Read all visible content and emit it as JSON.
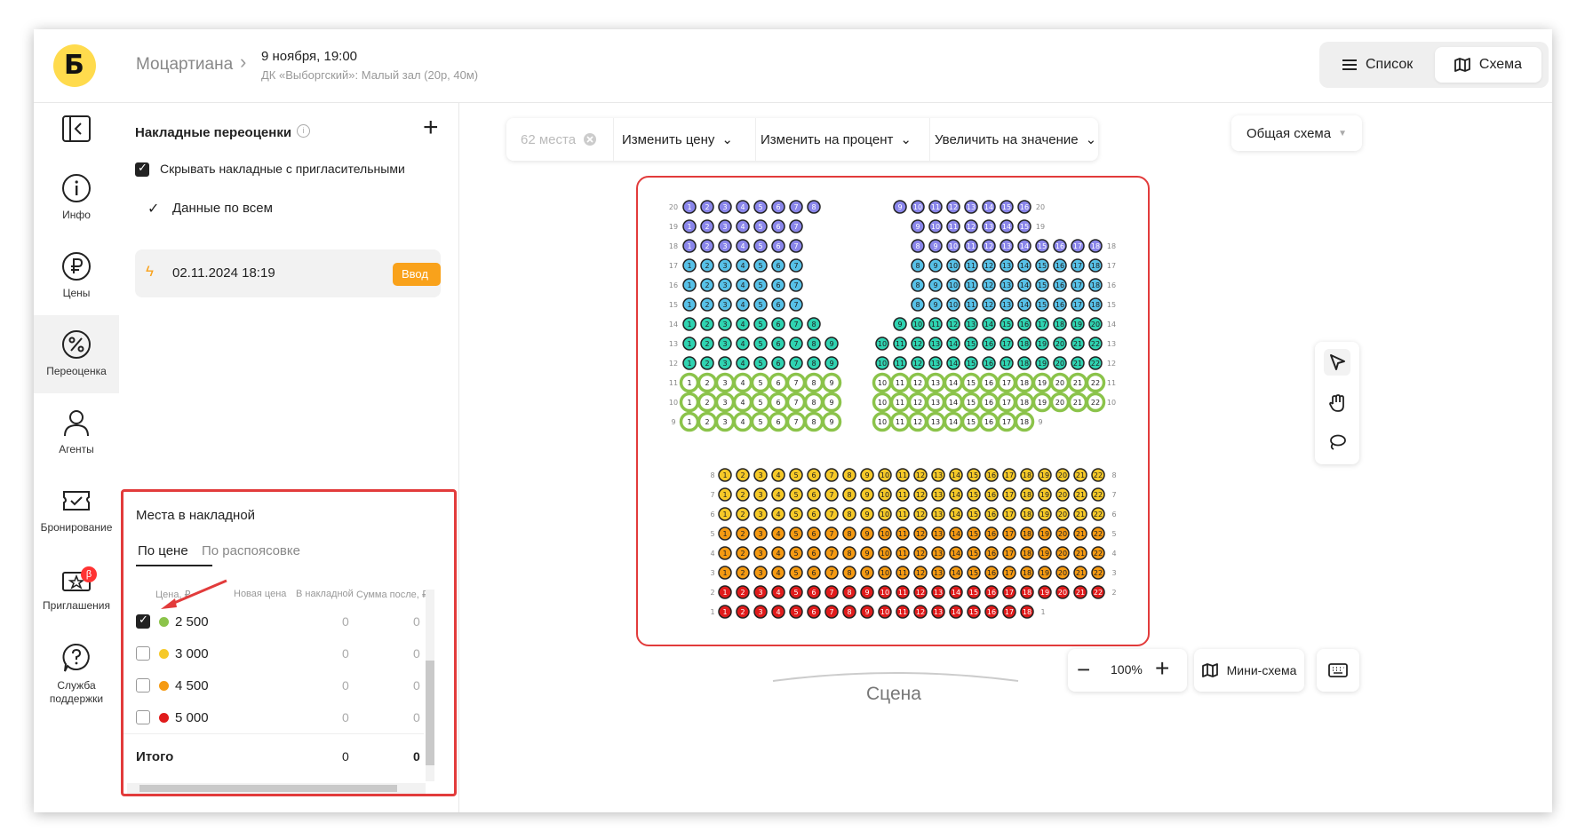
{
  "header": {
    "breadcrumb": "Моцартиана",
    "event_date": "9 ноября, 19:00",
    "event_place": "ДК «Выборгский»: Малый зал (20р, 40м)",
    "view_list": "Список",
    "view_scheme": "Схема"
  },
  "sidebar": {
    "items": [
      {
        "label": "",
        "icon": "collapse-panel-icon"
      },
      {
        "label": "Инфо",
        "icon": "info-icon"
      },
      {
        "label": "Цены",
        "icon": "ruble-icon"
      },
      {
        "label": "Переоценка",
        "icon": "percent-icon"
      },
      {
        "label": "Агенты",
        "icon": "person-icon"
      },
      {
        "label": "Бронирование",
        "icon": "ticket-icon"
      },
      {
        "label": "Приглашения",
        "icon": "invitation-icon",
        "badge": "β"
      },
      {
        "label": "Служба поддержки",
        "icon": "help-icon"
      }
    ]
  },
  "panel": {
    "title": "Накладные переоценки",
    "hide_invites_label": "Скрывать накладные с пригласительными",
    "hide_invites_checked": true,
    "all_data_label": "Данные по всем",
    "entry_date": "02.11.2024 18:19",
    "entry_button": "Ввод"
  },
  "seats_box": {
    "title": "Места в накладной",
    "tabs": [
      "По цене",
      "По распояcовке"
    ],
    "columns": [
      "Цена, ₽",
      "Новая цена",
      "В накладной",
      "Сумма после, ₽"
    ],
    "rows": [
      {
        "price": "2 500",
        "color": "#8bc34a",
        "checked": true,
        "count": "0",
        "sum": "0"
      },
      {
        "price": "3 000",
        "color": "#f6c928",
        "checked": false,
        "count": "0",
        "sum": "0"
      },
      {
        "price": "4 500",
        "color": "#f59a12",
        "checked": false,
        "count": "0",
        "sum": "0"
      },
      {
        "price": "5 000",
        "color": "#e01b1b",
        "checked": false,
        "count": "0",
        "sum": "0"
      }
    ],
    "total_label": "Итого",
    "total_count": "0",
    "total_sum": "0"
  },
  "toolbar": {
    "selected": "62 места",
    "change_price": "Изменить цену",
    "change_percent": "Изменить на процент",
    "increase_value": "Увеличить на значение"
  },
  "common_scheme": "Общая схема",
  "zoom": "100%",
  "mini_scheme": "Мини-схема",
  "stage": "Сцена",
  "colors": {
    "purple": "#8a86ea",
    "blue": "#57c1e8",
    "teal": "#2fd3b1",
    "green": "#8bc34a",
    "yellow": "#f6c928",
    "orange": "#f59a12",
    "red": "#e01b1b",
    "accent": "#f9a21b",
    "highlight_border": "#e23b3b"
  }
}
